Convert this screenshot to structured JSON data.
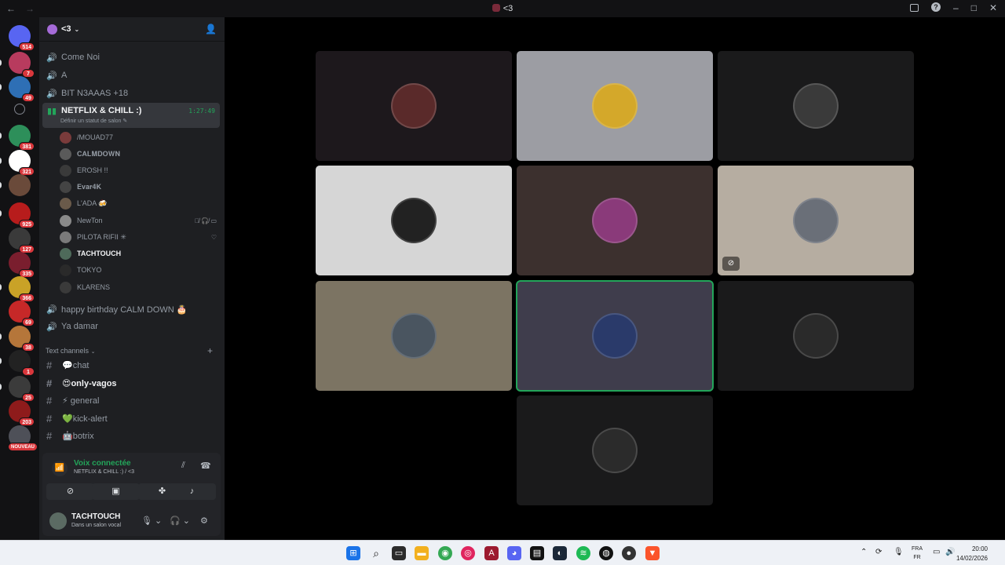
{
  "window": {
    "title": "<3",
    "back": "←",
    "forward": "→"
  },
  "titlebar_icons": {
    "inbox": "inbox-icon",
    "help": "?",
    "minimize": "–",
    "maximize": "□",
    "close": "✕"
  },
  "rail": {
    "servers": [
      {
        "badge": "514",
        "color": "#5865f2"
      },
      {
        "badge": "7",
        "color": "#b83b5e"
      },
      {
        "badge": "49",
        "color": "#2e6fb5"
      },
      {
        "badge": "",
        "color": "#121214"
      },
      {
        "badge": "381",
        "color": "#2d8f5a"
      },
      {
        "badge": "321",
        "color": "#ffffff"
      },
      {
        "badge": "",
        "color": "#6a4a3a"
      },
      {
        "badge": "925",
        "color": "#b71c1c"
      },
      {
        "badge": "127",
        "color": "#3a3a3a"
      },
      {
        "badge": "335",
        "color": "#7a1e2e"
      },
      {
        "badge": "366",
        "color": "#c9a227"
      },
      {
        "badge": "69",
        "color": "#c62828"
      },
      {
        "badge": "38",
        "color": "#b5763a"
      },
      {
        "badge": "1",
        "color": "#222222"
      },
      {
        "badge": "25",
        "color": "#3b3b3b"
      },
      {
        "badge": "203",
        "color": "#8e1b1b"
      },
      {
        "badge": "NOUVEAU",
        "color": "#4e5058"
      }
    ]
  },
  "server": {
    "name": "<3",
    "invite_icon": "add-member-icon"
  },
  "voice_channels": [
    {
      "name": "Come Noi"
    },
    {
      "name": "A"
    },
    {
      "name": "BIT N3AAAS +18"
    }
  ],
  "active_channel": {
    "name": "NETFLIX & CHILL :)",
    "status": "Définir un statut de salon ✎",
    "timer": "1:27:49"
  },
  "members": [
    {
      "name": "/MOUAD77",
      "bold": false
    },
    {
      "name": "𝐂𝐀𝐋𝐌𝐃𝐎𝐖𝐍",
      "bold": false
    },
    {
      "name": "EROSH !!",
      "bold": false
    },
    {
      "name": "𝐄𝐯𝐚𝐫𝟒𝐊",
      "bold": false
    },
    {
      "name": "L'ADA 🍻",
      "bold": false
    },
    {
      "name": "NewTon",
      "bold": false,
      "icons": "🎙̸ 🎧̸ ▭"
    },
    {
      "name": "PILOTA RIFII ✳",
      "bold": false,
      "icons": "♡"
    },
    {
      "name": "TACHTOUCH",
      "bold": true
    },
    {
      "name": "TOKYO",
      "bold": false
    },
    {
      "name": "KLARENS",
      "bold": false
    }
  ],
  "more_voice": [
    {
      "name": "happy birthday CALM DOWN 🎂"
    },
    {
      "name": "Ya damar"
    }
  ],
  "text_category": {
    "label": "Text channels",
    "add": "+"
  },
  "text_channels": [
    {
      "name": "💬chat",
      "bold": false
    },
    {
      "name": "😍only-vagos",
      "bold": true
    },
    {
      "name": "⚡ general",
      "bold": false
    },
    {
      "name": "💚kick-alert",
      "bold": false
    },
    {
      "name": "🤖botrix",
      "bold": false
    }
  ],
  "voice_panel": {
    "status": "Voix connectée",
    "location": "NETFLIX & CHILL :) / <3",
    "buttons": [
      "camera-off-icon",
      "screen-share-icon",
      "activities-icon",
      "soundboard-icon"
    ]
  },
  "user": {
    "name": "TACHTOUCH",
    "status": "Dans un salon vocal"
  },
  "tiles": [
    {
      "bg": "#1d181c",
      "av": "#5a2a2a",
      "muted": false,
      "speaking": false
    },
    {
      "bg": "#9c9da3",
      "av": "#d4a82a",
      "muted": false,
      "speaking": false
    },
    {
      "bg": "#1a1a1b",
      "av": "#3a3a3a",
      "muted": false,
      "speaking": false
    },
    {
      "bg": "#d6d6d6",
      "av": "#222222",
      "muted": false,
      "speaking": false
    },
    {
      "bg": "#3c302e",
      "av": "#8a3a7a",
      "muted": false,
      "speaking": false
    },
    {
      "bg": "#b6ada1",
      "av": "#6a6f78",
      "muted": true,
      "speaking": false
    },
    {
      "bg": "#7c7463",
      "av": "#4a5560",
      "muted": false,
      "speaking": false
    },
    {
      "bg": "#3f3d4c",
      "av": "#2a3a6a",
      "muted": false,
      "speaking": true
    },
    {
      "bg": "#1a1a1b",
      "av": "#2a2a2a",
      "muted": false,
      "speaking": false
    },
    {
      "bg": "#1a1a1b",
      "av": "#2b2b2b",
      "muted": false,
      "speaking": false
    }
  ],
  "taskbar": {
    "lang_top": "FRA",
    "lang_bottom": "FR",
    "time": "20:00",
    "date": "14/02/2026"
  }
}
